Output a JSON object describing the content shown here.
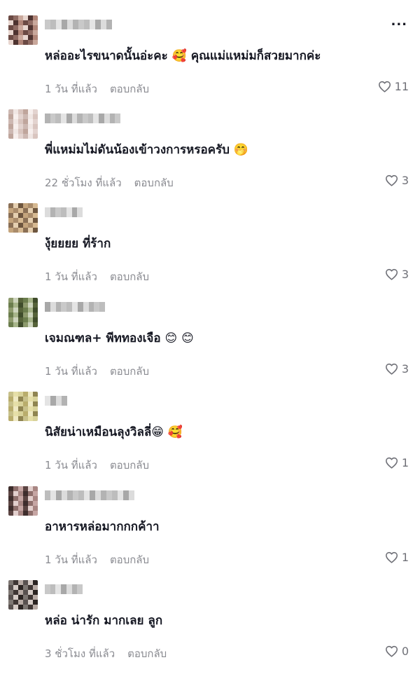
{
  "menu": {
    "more_label": "..."
  },
  "comments": [
    {
      "text": "หล่ออะไรขนาดนั้นอ่ะคะ 🥰 คุณแม่แหม่มก็สวยมากค่ะ",
      "time": "1 วัน ที่แล้ว",
      "reply": "ตอบกลับ",
      "likes": "11"
    },
    {
      "text": "พี่แหม่มไม่ดันน้องเข้าวงการหรอครับ 🤭",
      "time": "22 ชั่วโมง ที่แล้ว",
      "reply": "ตอบกลับ",
      "likes": "3"
    },
    {
      "text": "งุ้ยยยย ที่ร้าก",
      "time": "1 วัน ที่แล้ว",
      "reply": "ตอบกลับ",
      "likes": "3"
    },
    {
      "text": "เจมณฑล+ พีททองเจือ 😊 😊",
      "time": "1 วัน ที่แล้ว",
      "reply": "ตอบกลับ",
      "likes": "3"
    },
    {
      "text": "นิสัยน่าเหมือนลุงวิลลี่😁 🥰",
      "time": "1 วัน ที่แล้ว",
      "reply": "ตอบกลับ",
      "likes": "1"
    },
    {
      "text": "อาหารหล่อมากกกค้าา",
      "time": "1 วัน ที่แล้ว",
      "reply": "ตอบกลับ",
      "likes": "1"
    },
    {
      "text": "หล่อ น่ารัก มากเลย ลูก",
      "time": "3 ชั่วโมง ที่แล้ว",
      "reply": "ตอบกลับ",
      "likes": "0"
    }
  ],
  "colors": {
    "text": "#161823",
    "meta": "#8a8b91",
    "background": "#ffffff"
  },
  "icons": {
    "like": "heart-outline-icon",
    "more": "more-horizontal-icon"
  }
}
